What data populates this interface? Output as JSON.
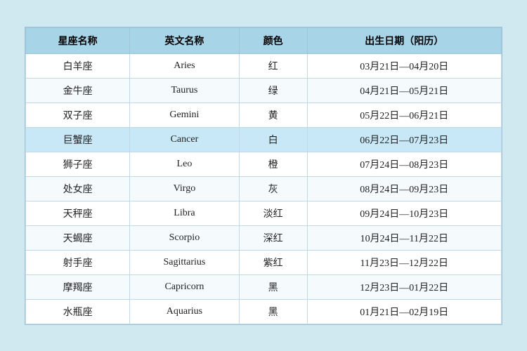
{
  "table": {
    "headers": [
      "星座名称",
      "英文名称",
      "颜色",
      "出生日期（阳历）"
    ],
    "rows": [
      {
        "chinese": "白羊座",
        "english": "Aries",
        "color": "红",
        "dates": "03月21日—04月20日",
        "highlight": false
      },
      {
        "chinese": "金牛座",
        "english": "Taurus",
        "color": "绿",
        "dates": "04月21日—05月21日",
        "highlight": false
      },
      {
        "chinese": "双子座",
        "english": "Gemini",
        "color": "黄",
        "dates": "05月22日—06月21日",
        "highlight": false
      },
      {
        "chinese": "巨蟹座",
        "english": "Cancer",
        "color": "白",
        "dates": "06月22日—07月23日",
        "highlight": true
      },
      {
        "chinese": "狮子座",
        "english": "Leo",
        "color": "橙",
        "dates": "07月24日—08月23日",
        "highlight": false
      },
      {
        "chinese": "处女座",
        "english": "Virgo",
        "color": "灰",
        "dates": "08月24日—09月23日",
        "highlight": false
      },
      {
        "chinese": "天秤座",
        "english": "Libra",
        "color": "淡红",
        "dates": "09月24日—10月23日",
        "highlight": false
      },
      {
        "chinese": "天蝎座",
        "english": "Scorpio",
        "color": "深红",
        "dates": "10月24日—11月22日",
        "highlight": false
      },
      {
        "chinese": "射手座",
        "english": "Sagittarius",
        "color": "紫红",
        "dates": "11月23日—12月22日",
        "highlight": false
      },
      {
        "chinese": "摩羯座",
        "english": "Capricorn",
        "color": "黑",
        "dates": "12月23日—01月22日",
        "highlight": false
      },
      {
        "chinese": "水瓶座",
        "english": "Aquarius",
        "color": "黑",
        "dates": "01月21日—02月19日",
        "highlight": false
      }
    ]
  }
}
